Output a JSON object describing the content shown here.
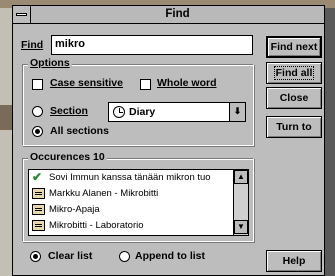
{
  "dialog": {
    "title": "Find",
    "find_label": "Find",
    "find_value": "mikro"
  },
  "options": {
    "group_label": "Options",
    "case_sensitive": "Case sensitive",
    "whole_word": "Whole word",
    "section_label": "Section",
    "section_value": "Diary",
    "all_sections": "All sections",
    "selected_scope": "All sections"
  },
  "occurences": {
    "group_label": "Occurences 10",
    "items": [
      {
        "icon": "check-icon",
        "text": "Sovi Immun kanssa tänään mikron tuo"
      },
      {
        "icon": "document-icon",
        "text": "Markku Alanen - Mikrobitti"
      },
      {
        "icon": "document-icon",
        "text": "Mikro-Apaja"
      },
      {
        "icon": "document-icon",
        "text": "Mikrobitti - Laboratorio"
      }
    ],
    "clear_list": "Clear list",
    "append_to_list": "Append to list",
    "selected_mode": "Clear list"
  },
  "buttons": {
    "find_next": "Find next",
    "find_all": "Find all",
    "close": "Close",
    "turn_to": "Turn to",
    "help": "Help"
  }
}
